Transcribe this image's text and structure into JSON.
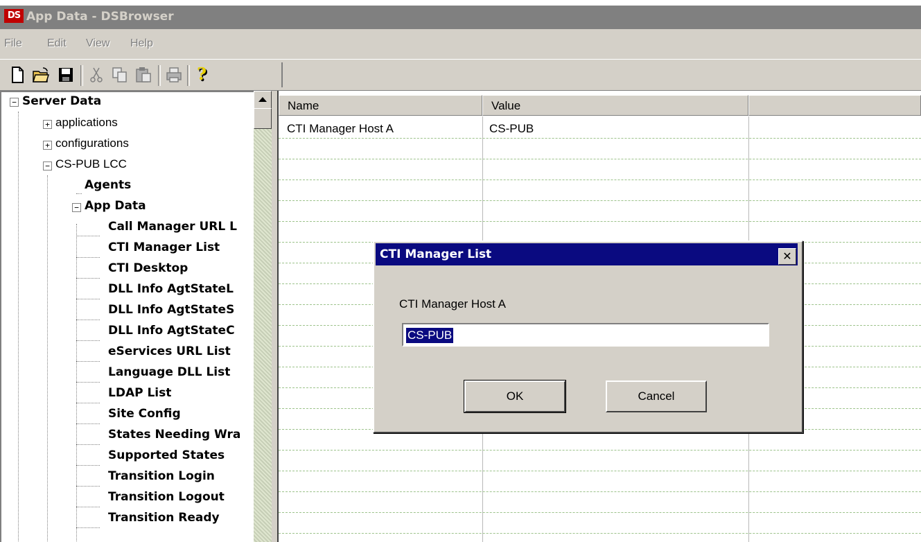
{
  "window": {
    "title": "App Data - DSBrowser",
    "icon": "ds-app-icon"
  },
  "menu": [
    "File",
    "Edit",
    "View",
    "Help"
  ],
  "toolbar": [
    "new-icon",
    "open-icon",
    "save-icon",
    "cut-icon",
    "copy-icon",
    "paste-icon",
    "print-icon",
    "help-icon"
  ],
  "tree": {
    "root": "Server Data",
    "applications": "applications",
    "configurations": "configurations",
    "lcc": "CS-PUB LCC",
    "agents": "Agents",
    "app_data": "App Data",
    "app_items": [
      "Call Manager URL L",
      "CTI Manager List",
      "CTI Desktop",
      "DLL Info AgtStateL",
      "DLL Info AgtStateS",
      "DLL Info AgtStateC",
      "eServices URL List",
      "Language DLL List",
      "LDAP List",
      "Site Config",
      "States Needing Wra",
      "Supported States",
      "Transition Login",
      "Transition Logout",
      "Transition Ready"
    ]
  },
  "list": {
    "columns": [
      "Name",
      "Value"
    ],
    "rows": [
      {
        "name": "CTI Manager Host A",
        "value": "CS-PUB"
      }
    ]
  },
  "dialog": {
    "title": "CTI Manager List",
    "close": "✕",
    "label": "CTI Manager Host A",
    "input_value": "CS-PUB",
    "ok": "OK",
    "cancel": "Cancel"
  },
  "colors": {
    "dialog_title_bg": "#0a0a80",
    "inactive_title_bg": "#808080",
    "face": "#d4d0c8"
  }
}
